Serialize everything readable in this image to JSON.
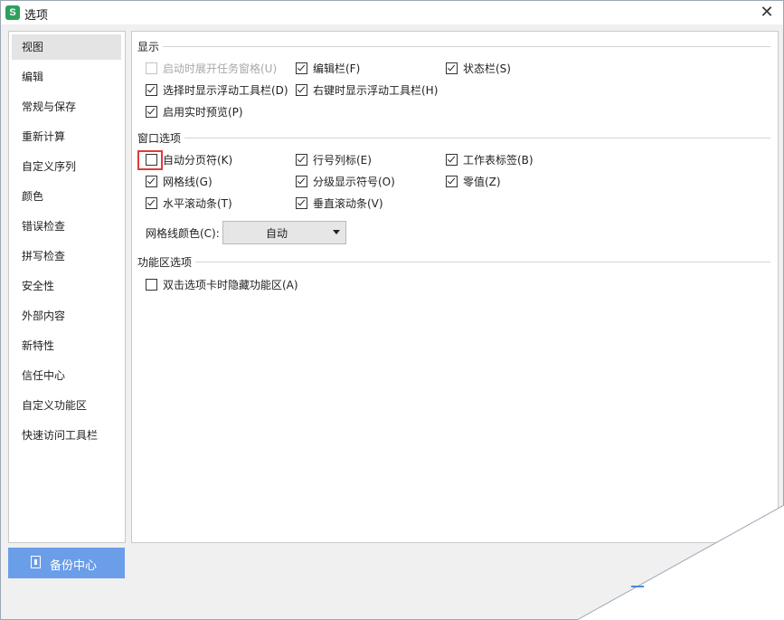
{
  "window": {
    "title": "选项",
    "app_icon": "S",
    "close_glyph": "✕"
  },
  "sidebar": {
    "items": [
      {
        "label": "视图",
        "active": true
      },
      {
        "label": "编辑"
      },
      {
        "label": "常规与保存"
      },
      {
        "label": "重新计算"
      },
      {
        "label": "自定义序列"
      },
      {
        "label": "颜色"
      },
      {
        "label": "错误检查"
      },
      {
        "label": "拼写检查"
      },
      {
        "label": "安全性"
      },
      {
        "label": "外部内容"
      },
      {
        "label": "新特性"
      },
      {
        "label": "信任中心"
      },
      {
        "label": "自定义功能区"
      },
      {
        "label": "快速访问工具栏"
      }
    ],
    "backup_button": "备份中心"
  },
  "display": {
    "title": "显示",
    "options": [
      {
        "label": "启动时展开任务窗格(U)",
        "checked": false,
        "disabled": true
      },
      {
        "label": "编辑栏(F)",
        "checked": true
      },
      {
        "label": "状态栏(S)",
        "checked": true
      },
      {
        "label": "选择时显示浮动工具栏(D)",
        "checked": true
      },
      {
        "label": "右键时显示浮动工具栏(H)",
        "checked": true
      },
      {
        "label": "启用实时预览(P)",
        "checked": true
      }
    ]
  },
  "window_options": {
    "title": "窗口选项",
    "options": [
      {
        "label": "自动分页符(K)",
        "checked": false
      },
      {
        "label": "行号列标(E)",
        "checked": true
      },
      {
        "label": "工作表标签(B)",
        "checked": true
      },
      {
        "label": "网格线(G)",
        "checked": true
      },
      {
        "label": "分级显示符号(O)",
        "checked": true
      },
      {
        "label": "零值(Z)",
        "checked": true
      },
      {
        "label": "水平滚动条(T)",
        "checked": true
      },
      {
        "label": "垂直滚动条(V)",
        "checked": true
      }
    ],
    "gridline_color_label": "网格线颜色(C):",
    "gridline_color_value": "自动"
  },
  "ribbon": {
    "title": "功能区选项",
    "options": [
      {
        "label": "双击选项卡时隐藏功能区(A)",
        "checked": false
      }
    ]
  },
  "colors": {
    "accent": "#6b9ee8",
    "highlight": "#e23a3a",
    "app_icon_bg": "#2ea05c"
  },
  "icons": {
    "close": "close-icon",
    "backup": "document-icon",
    "dropdown": "chevron-down-icon",
    "check": "checkmark-icon"
  }
}
